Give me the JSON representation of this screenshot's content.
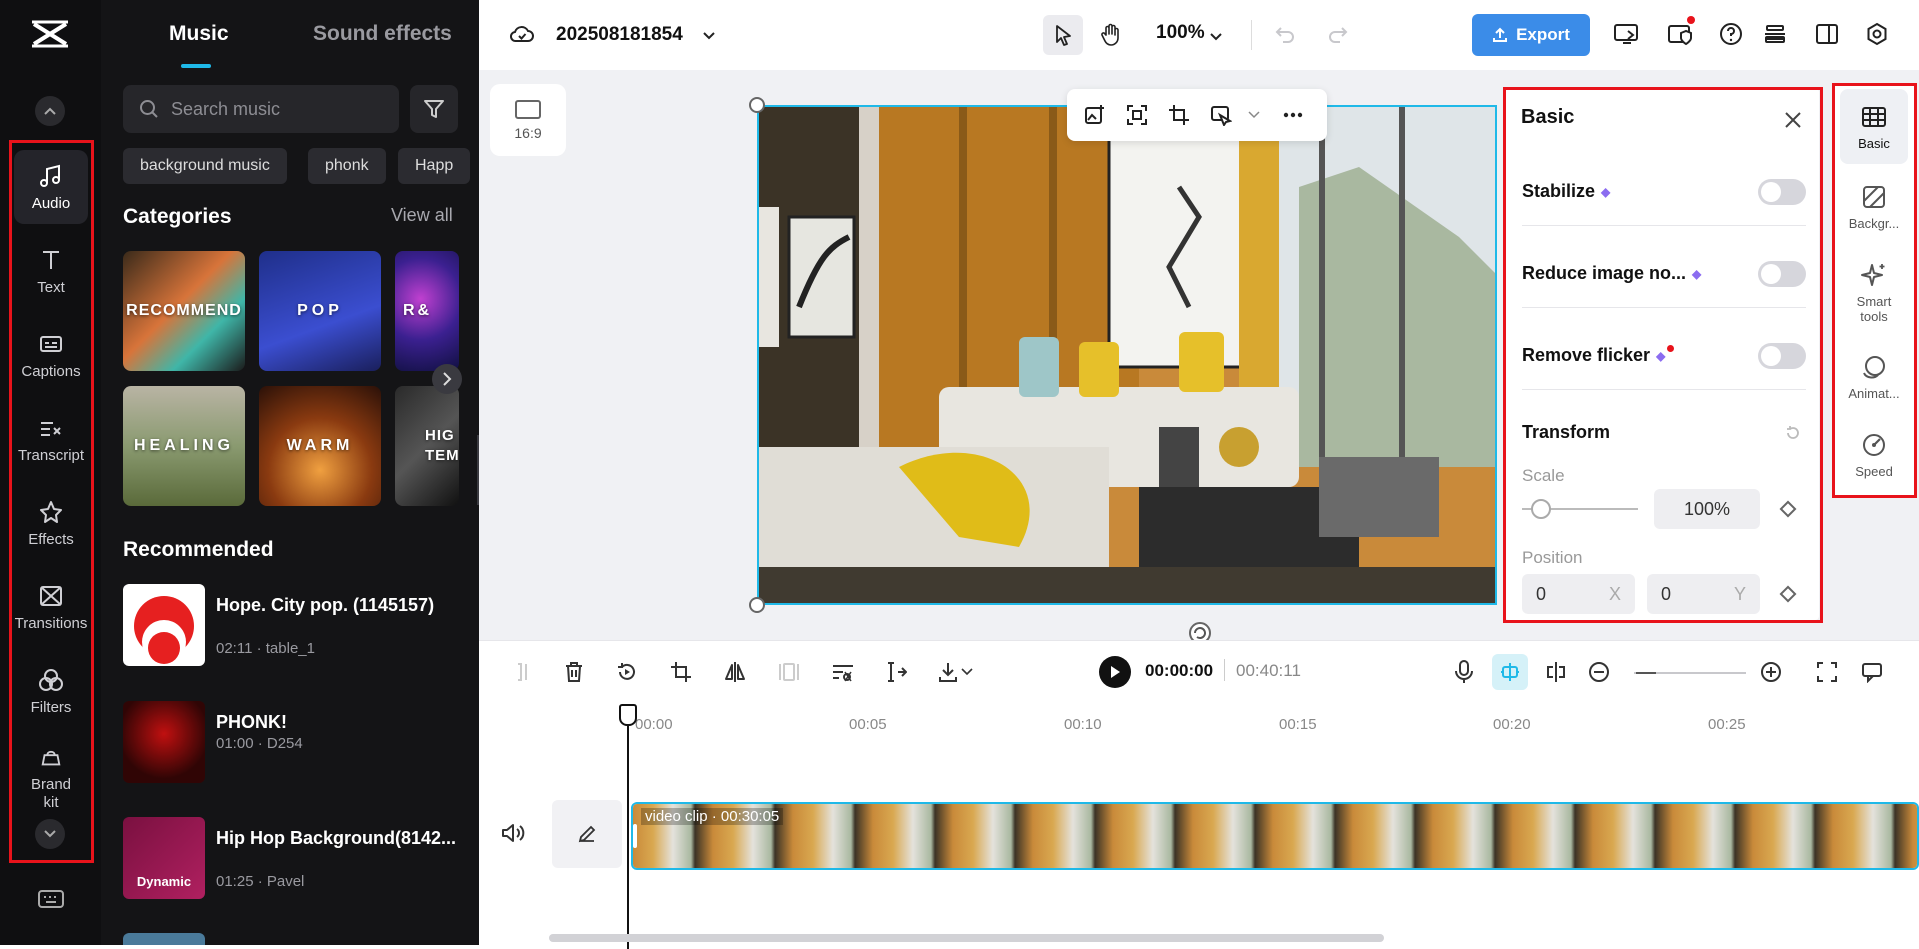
{
  "rail": {
    "items": [
      {
        "label": "Audio",
        "icon": "music-note-icon",
        "active": true
      },
      {
        "label": "Text",
        "icon": "text-icon"
      },
      {
        "label": "Captions",
        "icon": "captions-icon"
      },
      {
        "label": "Transcript",
        "icon": "transcript-icon"
      },
      {
        "label": "Effects",
        "icon": "effects-icon"
      },
      {
        "label": "Transitions",
        "icon": "transitions-icon"
      },
      {
        "label": "Filters",
        "icon": "filters-icon"
      },
      {
        "label": "Brand kit",
        "icon": "brand-kit-icon"
      }
    ]
  },
  "library": {
    "tabs": [
      "Music",
      "Sound effects"
    ],
    "search_placeholder": "Search music",
    "chips": [
      "background music",
      "phonk",
      "Happ"
    ],
    "categories_title": "Categories",
    "view_all": "View all",
    "categories": [
      "RECOMMEND",
      "POP",
      "R&",
      "HEALING",
      "WARM",
      "HIG TEM"
    ],
    "recommended_title": "Recommended",
    "tracks": [
      {
        "name": "Hope. City pop. (1145157)",
        "meta": "02:11 · table_1"
      },
      {
        "name": "PHONK!",
        "meta": "01:00 · D254"
      },
      {
        "name": "Hip Hop Background(8142...",
        "meta": "01:25 · Pavel",
        "badge": "Dynamic"
      }
    ]
  },
  "topbar": {
    "project_name": "202508181854",
    "zoom": "100%",
    "export_label": "Export",
    "accent": "#3b8ce8"
  },
  "canvas": {
    "ratio_label": "16:9"
  },
  "basic_panel": {
    "title": "Basic",
    "stabilize": "Stabilize",
    "reduce_noise": "Reduce image no...",
    "remove_flicker": "Remove flicker",
    "transform": "Transform",
    "scale_label": "Scale",
    "scale_value": "100%",
    "position_label": "Position",
    "pos_x": "0",
    "pos_x_label": "X",
    "pos_y": "0",
    "pos_y_label": "Y"
  },
  "right_rail": {
    "items": [
      {
        "label": "Basic",
        "active": true
      },
      {
        "label": "Backgr..."
      },
      {
        "label": "Smart tools"
      },
      {
        "label": "Animat..."
      },
      {
        "label": "Speed"
      }
    ]
  },
  "timeline": {
    "current_time": "00:00:00",
    "total_time": "00:40:11",
    "ticks": [
      "00:00",
      "00:05",
      "00:10",
      "00:15",
      "00:20",
      "00:25"
    ],
    "clip_label": "video clip",
    "clip_duration": "00:30:05"
  }
}
